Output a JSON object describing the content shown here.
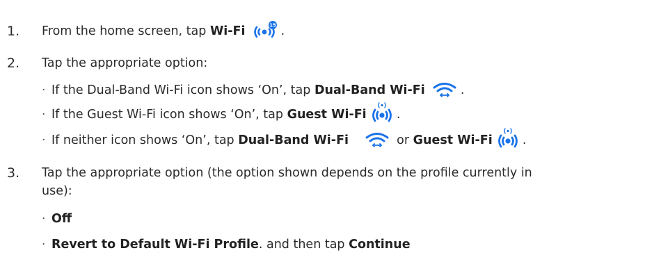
{
  "steps": [
    {
      "number": "1.",
      "pre": "From the home screen, tap ",
      "bold": "Wi-Fi",
      "post": " .",
      "icon_badge": "15"
    },
    {
      "number": "2.",
      "text": "Tap the appropriate option:",
      "bullets": [
        {
          "pre": "If the Dual-Band Wi-Fi icon shows ‘On’, tap ",
          "bold": "Dual-Band Wi-Fi",
          "post": " ."
        },
        {
          "pre": "If the Guest Wi-Fi icon shows ‘On’, tap ",
          "bold": "Guest Wi-Fi",
          "post": " ."
        },
        {
          "pre": "If neither icon shows ‘On’, tap ",
          "bold": "Dual-Band Wi-Fi",
          "mid": " or ",
          "bold2": "Guest Wi-Fi",
          "post": " ."
        }
      ]
    },
    {
      "number": "3.",
      "text_line1": "Tap the appropriate option (the option shown depends on the profile currently in",
      "text_line2": "use):",
      "bullets": [
        {
          "bold": "Off"
        },
        {
          "bold": "Revert to Default Wi-Fi Profile",
          "mid": ". and then tap ",
          "bold2": "Continue"
        }
      ]
    }
  ],
  "bullet_glyph": "·",
  "icons": {
    "wifi_broadcast": "broadcast-icon",
    "dual_band": "dual-band-wifi-icon",
    "guest": "guest-wifi-icon",
    "color": "#1a73e8"
  }
}
